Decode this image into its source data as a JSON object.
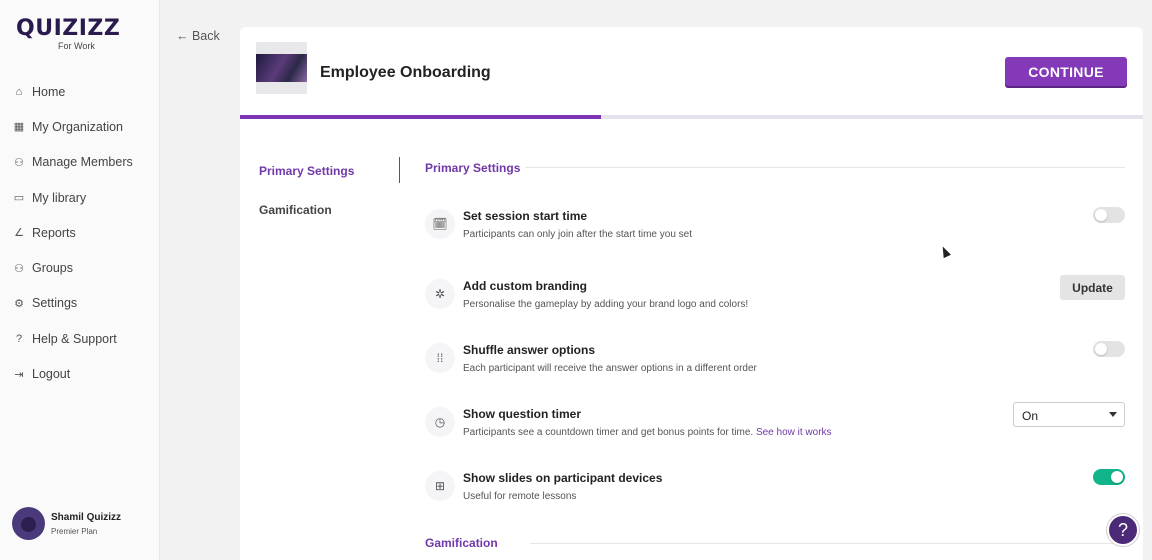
{
  "brand": {
    "logo": "QUIZIZZ",
    "sub": "For Work"
  },
  "sidebar": {
    "items": [
      {
        "label": "Home",
        "icon": "⌂"
      },
      {
        "label": "My Organization",
        "icon": "▦"
      },
      {
        "label": "Manage Members",
        "icon": "⚇"
      },
      {
        "label": "My library",
        "icon": "▭"
      },
      {
        "label": "Reports",
        "icon": "∠"
      },
      {
        "label": "Groups",
        "icon": "⚇"
      },
      {
        "label": "Settings",
        "icon": "⚙"
      },
      {
        "label": "Help & Support",
        "icon": "?"
      },
      {
        "label": "Logout",
        "icon": "⇥"
      }
    ]
  },
  "user": {
    "name": "Shamil Quizizz",
    "plan": "Premier Plan"
  },
  "back_label": "← Back",
  "quiz": {
    "title": "Employee Onboarding"
  },
  "continue_label": "CONTINUE",
  "progress": 0.4,
  "tabs": {
    "primary": "Primary Settings",
    "gamification": "Gamification"
  },
  "sections": {
    "primary": "Primary Settings",
    "gamification": "Gamification"
  },
  "settings": [
    {
      "title": "Set session start time",
      "desc": "Participants can only join after the start time you set",
      "icon": "🗓",
      "control": "toggle",
      "on": false
    },
    {
      "title": "Add custom branding",
      "desc": "Personalise the gameplay by adding your brand logo and colors!",
      "icon": "✲",
      "control": "button",
      "button_label": "Update"
    },
    {
      "title": "Shuffle answer options",
      "desc": "Each participant will receive the answer options in a different order",
      "icon": "⁞⁞",
      "control": "toggle",
      "on": false
    },
    {
      "title": "Show question timer",
      "desc": "Participants see a countdown timer and get bonus points for time.",
      "link": "See how it works",
      "icon": "◷",
      "control": "select",
      "value": "On"
    },
    {
      "title": "Show slides on participant devices",
      "desc": "Useful for remote lessons",
      "icon": "⊞",
      "control": "toggle",
      "on": true
    }
  ],
  "help_label": "?",
  "colors": {
    "primary": "#8339b8",
    "accent": "#7038a8",
    "toggle_on": "#10b58a"
  }
}
